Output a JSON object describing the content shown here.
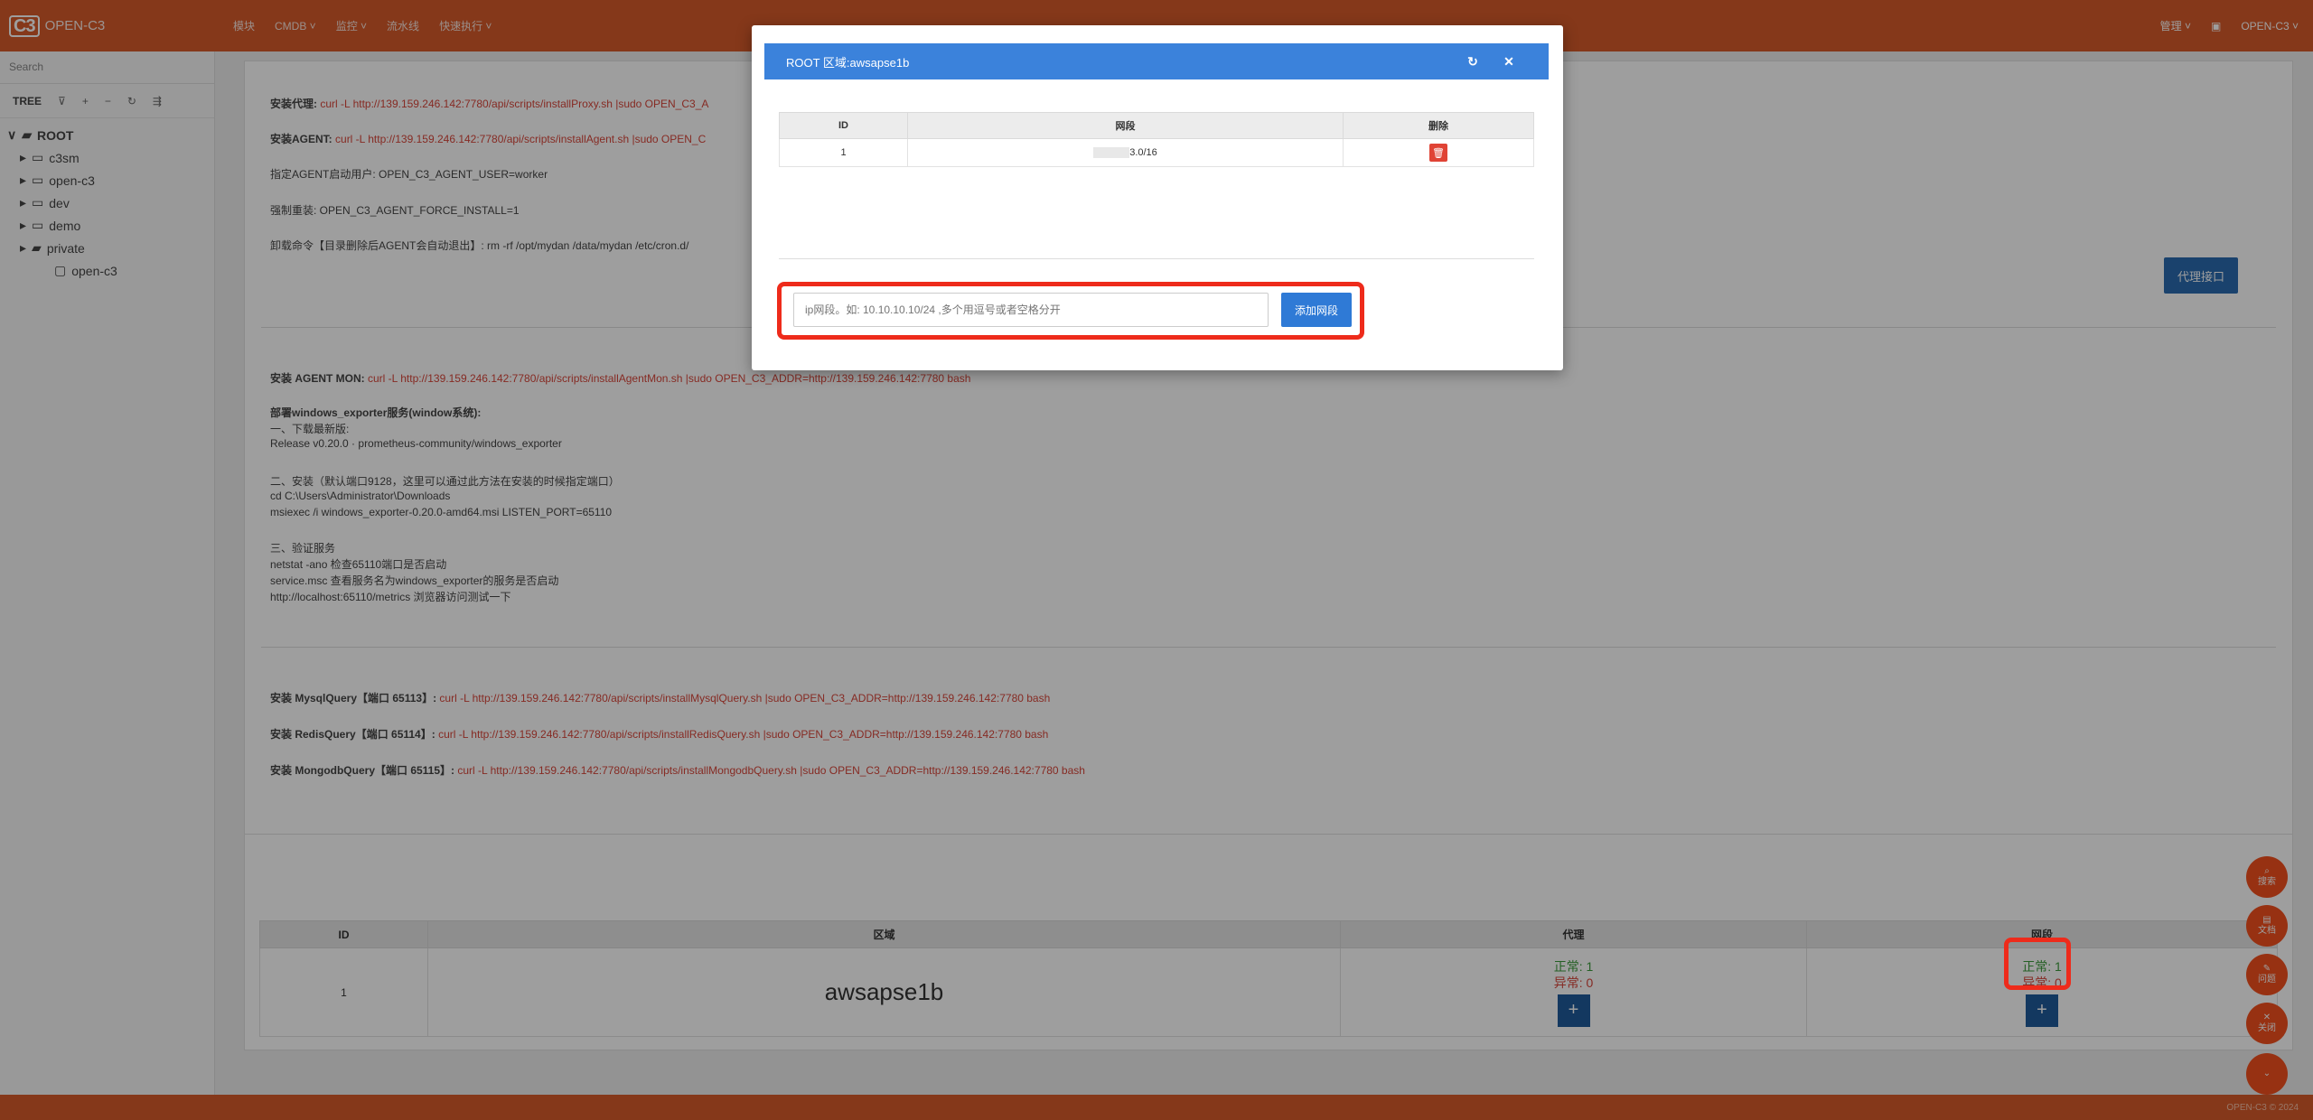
{
  "topbar": {
    "logo_mark": "C3",
    "logo_text": "OPEN-C3",
    "nav": [
      "模块",
      "CMDB ˅",
      "监控 ˅",
      "流水线",
      "快速执行 ˅"
    ],
    "right": [
      "管理 ˅",
      "▣",
      "OPEN-C3 ˅"
    ]
  },
  "sidebar": {
    "search_placeholder": "Search",
    "tree_label": "TREE",
    "toolbar_icons": [
      "⊽",
      "+",
      "−",
      "↻",
      "⇶"
    ],
    "nodes": [
      {
        "label": "ROOT",
        "level": "root",
        "caret": "∨",
        "icon": "▰"
      },
      {
        "label": "c3sm",
        "level": "l1",
        "caret": "▸",
        "icon": "▭"
      },
      {
        "label": "open-c3",
        "level": "l1",
        "caret": "▸",
        "icon": "▭"
      },
      {
        "label": "dev",
        "level": "l1",
        "caret": "▸",
        "icon": "▭"
      },
      {
        "label": "demo",
        "level": "l1",
        "caret": "▸",
        "icon": "▭"
      },
      {
        "label": "private",
        "level": "l1",
        "caret": "▸",
        "icon": "▰"
      },
      {
        "label": "open-c3",
        "level": "l2",
        "caret": "",
        "icon": "▢"
      }
    ]
  },
  "install": {
    "proxy_label": "安装代理: ",
    "proxy_cmd": "curl -L http://139.159.246.142:7780/api/scripts/installProxy.sh |sudo OPEN_C3_A",
    "agent_label": "安装AGENT: ",
    "agent_cmd": "curl -L http://139.159.246.142:7780/api/scripts/installAgent.sh |sudo OPEN_C",
    "agent_user": "指定AGENT启动用户: OPEN_C3_AGENT_USER=worker",
    "force_install": "强制重装: OPEN_C3_AGENT_FORCE_INSTALL=1",
    "uninstall": "卸载命令【目录删除后AGENT会自动退出】: rm -rf /opt/mydan /data/mydan /etc/cron.d/",
    "proxy_button": "代理接口",
    "agentmon_label": "安装 AGENT MON: ",
    "agentmon_cmd": "curl -L http://139.159.246.142:7780/api/scripts/installAgentMon.sh |sudo OPEN_C3_ADDR=http://139.159.246.142:7780 bash",
    "win_title": "部署windows_exporter服务(window系统):",
    "win_step1": "一、下载最新版:",
    "win_release": "Release v0.20.0 · prometheus-community/windows_exporter",
    "win_step2": "二、安装（默认端口9128，这里可以通过此方法在安装的时候指定端口）",
    "win_cd": "cd C:\\Users\\Administrator\\Downloads",
    "win_msiexec": "msiexec /i windows_exporter-0.20.0-amd64.msi LISTEN_PORT=65110",
    "win_step3": "三、验证服务",
    "win_netstat": "netstat -ano 检查65110端口是否启动",
    "win_service": "service.msc 查看服务名为windows_exporter的服务是否启动",
    "win_metrics": "http://localhost:65110/metrics 浏览器访问测试一下",
    "mysql_label": "安装 MysqlQuery【端口 65113】: ",
    "mysql_cmd": "curl -L http://139.159.246.142:7780/api/scripts/installMysqlQuery.sh |sudo OPEN_C3_ADDR=http://139.159.246.142:7780 bash",
    "redis_label": "安装 RedisQuery【端口 65114】: ",
    "redis_cmd": "curl -L http://139.159.246.142:7780/api/scripts/installRedisQuery.sh |sudo OPEN_C3_ADDR=http://139.159.246.142:7780 bash",
    "mongo_label": "安装 MongodbQuery【端口 65115】: ",
    "mongo_cmd": "curl -L http://139.159.246.142:7780/api/scripts/installMongodbQuery.sh |sudo OPEN_C3_ADDR=http://139.159.246.142:7780 bash"
  },
  "region_table": {
    "headers": [
      "ID",
      "区域",
      "代理",
      "网段"
    ],
    "row": {
      "id": "1",
      "region": "awsapse1b",
      "proxy_ok": "正常: 1",
      "proxy_bad": "异常: 0",
      "net_ok": "正常: 1",
      "net_bad": "异常: 0",
      "plus": "+"
    }
  },
  "fabs": [
    {
      "icon": "⌕",
      "label": "搜索"
    },
    {
      "icon": "▤",
      "label": "文档"
    },
    {
      "icon": "✎",
      "label": "问题"
    },
    {
      "icon": "✕",
      "label": "关闭"
    },
    {
      "icon": "⌄",
      "label": ""
    }
  ],
  "footer": "OPEN-C3 © 2024",
  "modal": {
    "title": "ROOT 区域:awsapse1b",
    "refresh_icon": "↻",
    "close_icon": "✕",
    "headers": [
      "ID",
      "网段",
      "删除"
    ],
    "row": {
      "id": "1",
      "segment_suffix": "3.0/16",
      "delete_icon": "🗑"
    },
    "input_placeholder": "ip网段。如: 10.10.10.10/24 ,多个用逗号或者空格分开",
    "add_button": "添加网段"
  },
  "colors": {
    "brand": "#d75b2b",
    "primary": "#3b82db",
    "danger": "#e04335",
    "highlight": "#ee2b1b",
    "fab": "#f4501e"
  }
}
